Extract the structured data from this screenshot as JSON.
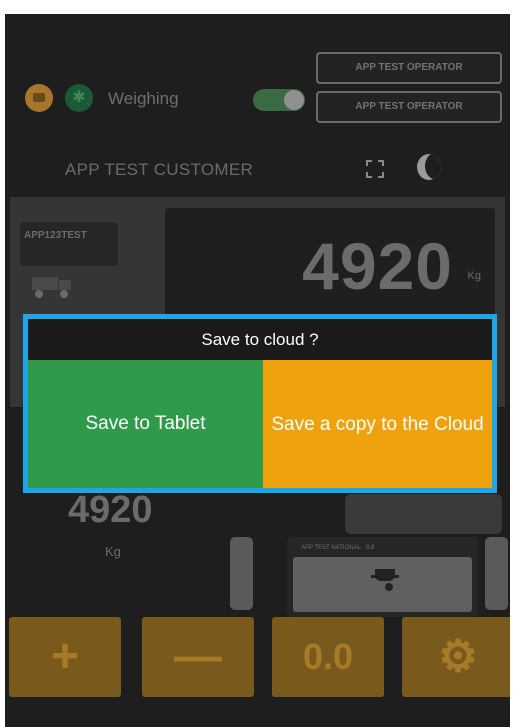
{
  "header": {
    "weighing_label": "Weighing",
    "weighing_toggle_on": true,
    "operator_1": "APP TEST OPERATOR",
    "operator_2": "APP TEST OPERATOR"
  },
  "customer": {
    "name": "APP TEST CUSTOMER"
  },
  "weigh_panel": {
    "plate": "APP123TEST",
    "weight": "4920",
    "unit": "Kg"
  },
  "lower_panel": {
    "weight": "4920",
    "unit": "Kg",
    "trailer_label": "APP TEST NATIONAL · 8.8"
  },
  "bottom_buttons": {
    "plus": "+",
    "minus": "—",
    "zero": "0.0",
    "settings_icon": "gear-icon"
  },
  "dialog": {
    "title": "Save to cloud ?",
    "save_tablet": "Save to Tablet",
    "save_cloud": "Save a copy to the Cloud"
  },
  "colors": {
    "save_tablet_bg": "#2e9a4a",
    "save_cloud_bg": "#f0a20e",
    "dialog_border": "#1ea6e8"
  }
}
